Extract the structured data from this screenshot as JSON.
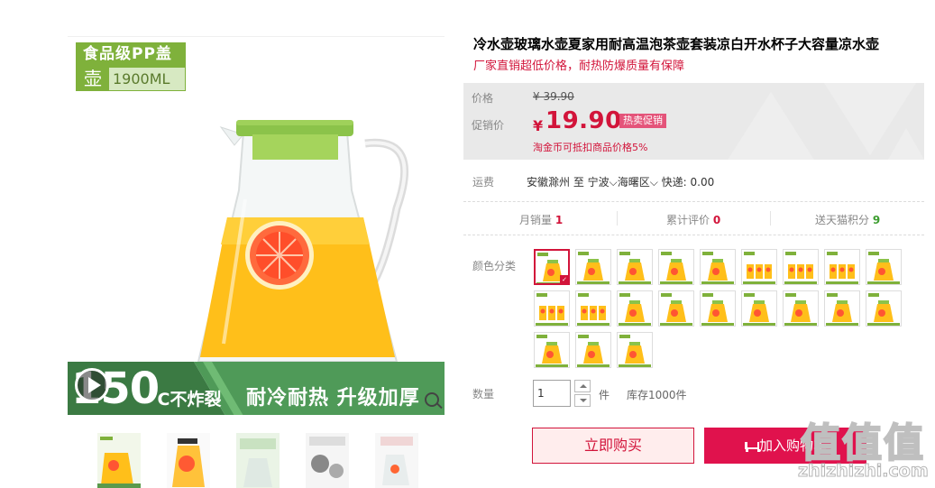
{
  "product": {
    "title": "冷水壶玻璃水壶夏家用耐高温泡茶壶套装凉白开水杯子大容量凉水壶",
    "subtitle": "厂家直销超低价格，耐热防爆质量有保障"
  },
  "image": {
    "badge_top": "食品级PP盖",
    "badge_hu": "壶",
    "badge_volume": "1900ML",
    "banner_number": "150",
    "banner_degree": "°C不炸裂",
    "banner_text": "耐冷耐热 升级加厚"
  },
  "price": {
    "label": "价格",
    "original": "¥ 39.90",
    "promo_label": "促销价",
    "currency": "¥",
    "promo": "19.90",
    "hot_tag": "热卖促销",
    "coin_note": "淘金币可抵扣商品价格5%"
  },
  "shipping": {
    "label": "运费",
    "text": "安徽滁州  至 宁波⌵海曙区⌵ 快递: 0.00"
  },
  "stats": {
    "monthly_label": "月销量",
    "monthly_value": "1",
    "reviews_label": "累计评价",
    "reviews_value": "0",
    "points_label": "送天猫积分",
    "points_value": "9"
  },
  "options": {
    "color_label": "颜色分类",
    "swatch_count": 21,
    "selected_index": 0
  },
  "quantity": {
    "label": "数量",
    "value": "1",
    "unit": "件",
    "stock": "库存1000件"
  },
  "actions": {
    "buy_now": "立即购买",
    "add_to_cart": "加入购物车"
  },
  "watermark": {
    "big": "值值值",
    "small": "zhizhizhi.com"
  },
  "colors": {
    "accent": "#d2143a",
    "cart_button": "#e0124d",
    "brand_green": "#7fb13b",
    "juice": "#ffb400"
  }
}
